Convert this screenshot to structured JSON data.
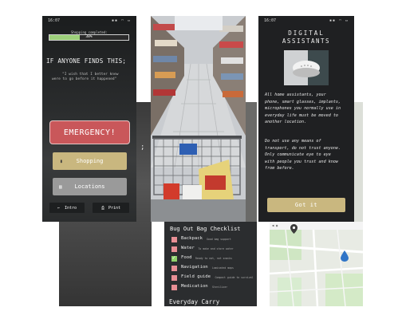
{
  "status": {
    "time": "16:07"
  },
  "emergency_screen": {
    "progress_label": "Shopping completed:",
    "progress_value": "38%",
    "progress_fraction": 0.38,
    "headline": "IF ANYONE FINDS THIS;",
    "quote_line1": "\"I wish that I better knew",
    "quote_line2": "were to go before it happened\"",
    "emergency_label": "EMERGENCY!",
    "shopping_label": "Shopping",
    "locations_label": "Locations",
    "intro_label": "Intro",
    "print_label": "Print"
  },
  "back_left": {
    "fragment": ";"
  },
  "digital_screen": {
    "title_line1": "DIGITAL",
    "title_line2": "ASSISTANTS",
    "paragraph1": [
      "All home assistants, your",
      "phone, smart glasses, implants,",
      "microphones you normally use in",
      "everyday life must be moved to",
      "another location."
    ],
    "paragraph2": [
      "Do not use any means of",
      "transport, do not trust anyone.",
      "Only communicate eye to eye",
      "with people you trust and know",
      "from before."
    ],
    "got_it_label": "Got it"
  },
  "checklist_screen": {
    "title": "Bug Out Bag Checklist",
    "items": [
      {
        "label": "Backpack",
        "note": "Good bag support",
        "checked": false
      },
      {
        "label": "Water",
        "note": "To make and store water",
        "checked": false
      },
      {
        "label": "Food",
        "note": "Ready to eat, not snacks",
        "checked": true
      },
      {
        "label": "Navigation",
        "note": "Laminated maps",
        "checked": false
      },
      {
        "label": "Field guide",
        "note": "Compact guide to survival",
        "checked": false
      },
      {
        "label": "Medication",
        "note": "Sterilizer",
        "checked": false
      }
    ],
    "footer": "Everyday Carry"
  },
  "colors": {
    "emergency_red": "#c9575a",
    "gold": "#c9b77f",
    "checkbox_pink": "#e88f95",
    "check_green": "#8fd16a",
    "map_water": "#2f74c7"
  }
}
